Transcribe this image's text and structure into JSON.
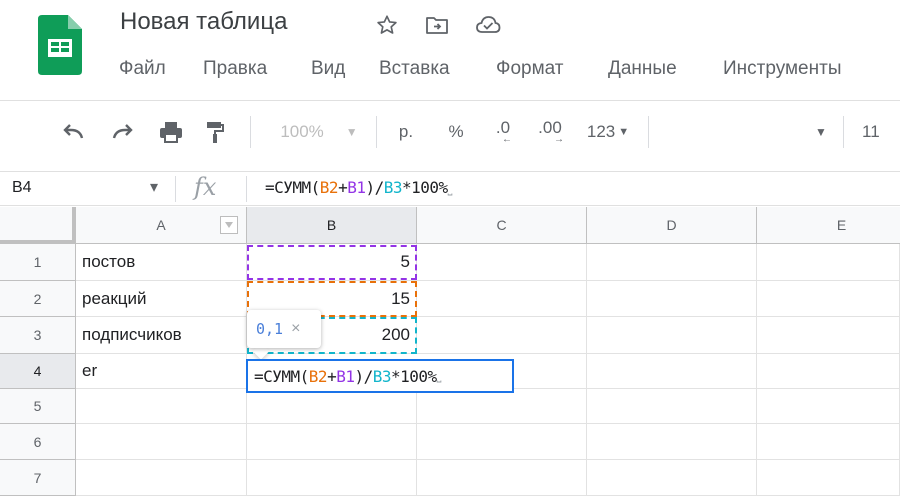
{
  "doc": {
    "title": "Новая таблица"
  },
  "menu": [
    "Файл",
    "Правка",
    "Вид",
    "Вставка",
    "Формат",
    "Данные",
    "Инструменты"
  ],
  "toolbar": {
    "zoom": "100%",
    "currency": "р.",
    "percent": "%",
    "decrease_decimals": ".0",
    "increase_decimals": ".00",
    "more_formats": "123",
    "font_size": "11"
  },
  "formula_bar": {
    "cell_ref": "B4",
    "fx": "fx",
    "formula_parts": [
      "=СУММ(",
      "B2",
      "+",
      "B1",
      ")/",
      "B3",
      "*100%",
      "⎵"
    ]
  },
  "grid": {
    "columns": [
      "A",
      "B",
      "C",
      "D",
      "E"
    ],
    "rows": [
      "1",
      "2",
      "3",
      "4",
      "5",
      "6",
      "7"
    ],
    "cells": {
      "A1": "постов",
      "B1": "5",
      "A2": "реакций",
      "B2": "15",
      "A3": "подписчиков",
      "B3": "200",
      "A4": "er"
    }
  },
  "editor": {
    "formula_parts": [
      "=СУММ(",
      "B2",
      "+",
      "B1",
      ")/",
      "B3",
      "*100%",
      "⎵"
    ],
    "preview_value": "0,1",
    "preview_close": "×"
  },
  "colors": {
    "ref_b1": "#9334e6",
    "ref_b2": "#e8710a",
    "ref_b3": "#12b5cb",
    "accent": "#1a73e8",
    "logo_green": "#0f9d58"
  },
  "icons": [
    "star-icon",
    "move-to-folder-icon",
    "cloud-saved-icon",
    "undo-icon",
    "redo-icon",
    "print-icon",
    "paint-format-icon"
  ]
}
